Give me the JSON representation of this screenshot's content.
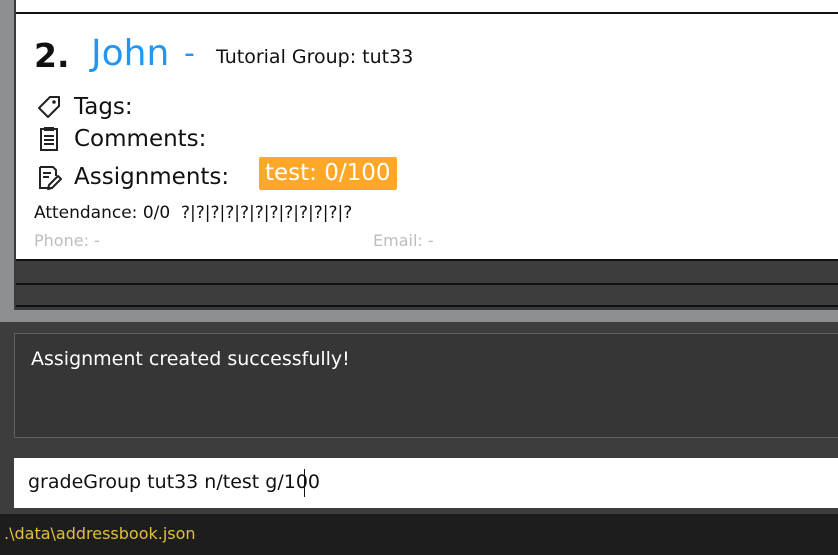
{
  "person_card": {
    "index": "2.",
    "name": "John",
    "separator": "-",
    "tutorial_group": "Tutorial Group: tut33",
    "tags_label": "Tags:",
    "comments_label": "Comments:",
    "assignments_label": "Assignments:",
    "assignment_badge": "test: 0/100",
    "attendance": "Attendance: 0/0  ?|?|?|?|?|?|?|?|?|?|?|?",
    "phone": "Phone:  -",
    "email": "Email:  -"
  },
  "result_display": {
    "message": "Assignment created successfully!"
  },
  "command_box": {
    "value": "gradeGroup tut33 n/test g/100"
  },
  "status_bar": {
    "path": ".\\data\\addressbook.json"
  },
  "colors": {
    "name": "#2196f3",
    "badge": "#ffa726",
    "status_text": "#e0c03a"
  },
  "icons": [
    "tag-icon",
    "notepad-icon",
    "edit-document-icon"
  ]
}
